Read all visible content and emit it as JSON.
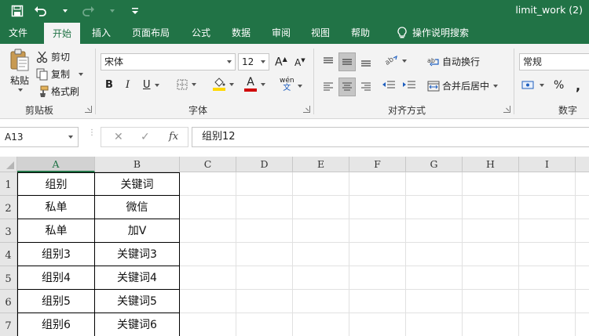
{
  "window": {
    "title": "limit_work (2)"
  },
  "tabs": [
    "文件",
    "开始",
    "插入",
    "页面布局",
    "公式",
    "数据",
    "审阅",
    "视图",
    "帮助",
    "操作说明搜索"
  ],
  "ribbon": {
    "clipboard": {
      "paste_label": "粘贴",
      "cut_label": "剪切",
      "copy_label": "复制",
      "format_painter_label": "格式刷",
      "group_label": "剪贴板"
    },
    "font": {
      "font_name": "宋体",
      "font_size": "12",
      "bold": "B",
      "italic": "I",
      "underline": "U",
      "font_color_glyph": "A",
      "pinyin_label": "wén",
      "pinyin_sub": "文",
      "group_label": "字体",
      "font_color": "#d00000",
      "fill_color": "#ffd800"
    },
    "alignment": {
      "wrap_text_label": "自动换行",
      "merge_center_label": "合并后居中",
      "group_label": "对齐方式"
    },
    "number": {
      "format_value": "常规",
      "percent": "%",
      "group_label": "数字"
    }
  },
  "formula_bar": {
    "name_box": "A13",
    "formula": "组别12",
    "cancel_glyph": "✕",
    "enter_glyph": "✓",
    "fx_glyph": "fx"
  },
  "sheet": {
    "columns": [
      "A",
      "B",
      "C",
      "D",
      "E",
      "F",
      "G",
      "H",
      "I"
    ],
    "rows": [
      "1",
      "2",
      "3",
      "4",
      "5",
      "6",
      "7"
    ],
    "cells": [
      [
        "组别",
        "关键词"
      ],
      [
        "私单",
        "微信"
      ],
      [
        "私单",
        "加V"
      ],
      [
        "组别3",
        "关键词3"
      ],
      [
        "组别4",
        "关键词4"
      ],
      [
        "组别5",
        "关键词5"
      ],
      [
        "组别6",
        "关键词6"
      ]
    ],
    "selected_column": "A"
  }
}
